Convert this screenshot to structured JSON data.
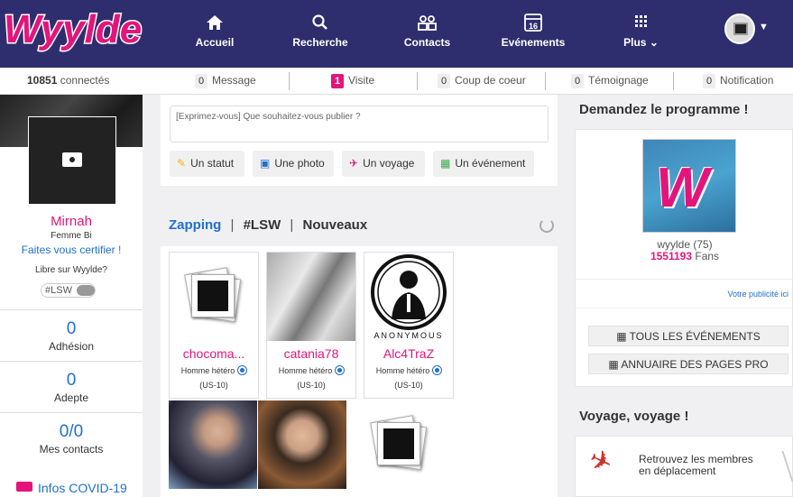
{
  "header": {
    "logo_text": "Wyylde",
    "nav": [
      {
        "label": "Accueil",
        "icon": "home-icon"
      },
      {
        "label": "Recherche",
        "icon": "search-icon"
      },
      {
        "label": "Contacts",
        "icon": "contacts-icon"
      },
      {
        "label": "Evénements",
        "icon": "calendar-icon",
        "icon_text": "16"
      },
      {
        "label": "Plus",
        "icon": "grid-icon"
      }
    ],
    "avatar_icon": "avatar-icon",
    "menu_icon": "chevron-down-icon"
  },
  "statusbar": {
    "connected_count": "10851",
    "connected_label": "connectés",
    "items": [
      {
        "count": "0",
        "label": "Message"
      },
      {
        "count": "1",
        "label": "Visite"
      },
      {
        "count": "0",
        "label": "Coup de coeur"
      },
      {
        "count": "0",
        "label": "Témoignage"
      },
      {
        "count": "0",
        "label": "Notification"
      }
    ]
  },
  "profile": {
    "name": "Mirnah",
    "gender": "Femme Bi",
    "certify_link": "Faites vous certifier !",
    "libre_label": "Libre sur Wyylde?",
    "toggle_label": "#LSW",
    "stats": [
      {
        "value": "0",
        "label": "Adhésion"
      },
      {
        "value": "0",
        "label": "Adepte"
      },
      {
        "value": "0/0",
        "label": "Mes contacts"
      }
    ],
    "covid_link": "Infos COVID-19"
  },
  "composer": {
    "placeholder": "[Exprimez-vous] Que souhaitez-vous publier ?",
    "buttons": [
      {
        "label": "Un statut",
        "icon": "pencil-icon"
      },
      {
        "label": "Une photo",
        "icon": "camera-plus-icon"
      },
      {
        "label": "Un voyage",
        "icon": "plane-icon"
      },
      {
        "label": "Un événement",
        "icon": "calendar-icon"
      }
    ]
  },
  "feed_tabs": [
    "Zapping",
    "#LSW",
    "Nouveaux"
  ],
  "members": [
    {
      "name": "chocoma...",
      "type": "Homme hétéro",
      "loc": "(US-10)"
    },
    {
      "name": "catania78",
      "type": "Homme hétéro",
      "loc": "(US-10)"
    },
    {
      "name": "Alc4TraZ",
      "type": "Homme hétéro",
      "loc": "(US-10)",
      "image_text": "ANONYMOUS"
    }
  ],
  "right": {
    "programme_title": "Demandez le programme !",
    "page_name": "wyylde (75)",
    "fans_count": "1551193",
    "fans_label": "Fans",
    "pub_link": "Votre publicité ici",
    "events_button": "TOUS LES ÉVÉNEMENTS",
    "annuaire_button": "ANNUAIRE DES PAGES PRO",
    "voyage_title": "Voyage, voyage !",
    "voyage_text_1": "Retrouvez les membres",
    "voyage_text_2": "en déplacement"
  },
  "colors": {
    "header": "#2e2e6e",
    "accent": "#e3157a",
    "link": "#1f6fd1"
  }
}
